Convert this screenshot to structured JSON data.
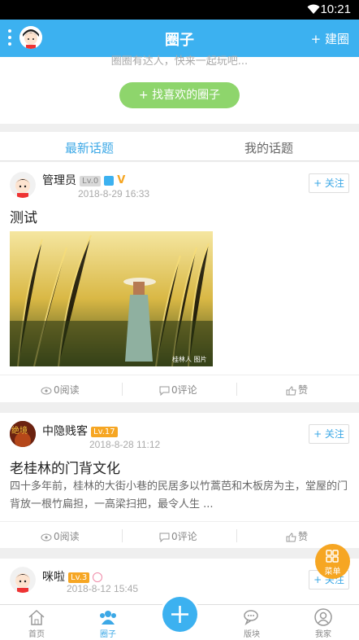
{
  "status_bar": {
    "time": "10:21"
  },
  "app_bar": {
    "title": "圈子",
    "create_label": "+ 建圈"
  },
  "hero": {
    "hint": "圈圈有达人，快来一起玩吧...",
    "find_button": "+ 找喜欢的圈子"
  },
  "tabs": [
    {
      "label": "最新话题"
    },
    {
      "label": "我的话题"
    }
  ],
  "follow_label": "+ 关注",
  "posts": [
    {
      "author": "管理员",
      "level": "Lv.0",
      "time": "2018-8-29 16:33",
      "title": "测试",
      "image_watermark": "桂林人 图片",
      "reads": "0阅读",
      "comments": "0评论",
      "likes": "赞"
    },
    {
      "author": "中隐贱客",
      "avatar_text": "绝境",
      "level": "Lv.17",
      "time": "2018-8-28 11:12",
      "title": "老桂林的门背文化",
      "body": "四十多年前，桂林的大街小巷的民居多以竹蒿芭和木板房为主，堂屋的门背放一根竹扁担，一高梁扫把，最令人生 ...",
      "reads": "0阅读",
      "comments": "0评论",
      "likes": "赞"
    },
    {
      "author": "咪啦",
      "level": "Lv.3",
      "time": "2018-8-12 15:45"
    }
  ],
  "fab_menu": {
    "label": "菜单"
  },
  "bottom_nav": [
    {
      "label": "首页"
    },
    {
      "label": "圈子"
    },
    {
      "label": "版块"
    },
    {
      "label": "我家"
    }
  ],
  "colors": {
    "primary": "#3cb1f0",
    "accent_green": "#8ed56c",
    "accent_orange": "#f6a623",
    "tab_active": "#3ca8e6"
  }
}
